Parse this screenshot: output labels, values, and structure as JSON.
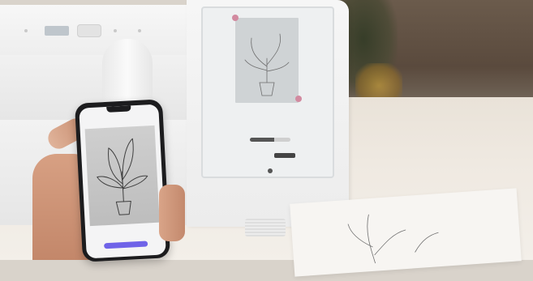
{
  "scene": {
    "description_label": "",
    "colors": {
      "machine_white": "#f2f2f2",
      "phone_black": "#1c1c1e",
      "phone_button": "#6f63e8",
      "screen_accent": "#d28aa0",
      "table": "#efe9e1"
    }
  },
  "phone": {
    "title": "",
    "button_label": ""
  },
  "machine_screen": {
    "caption": "",
    "left_label": "",
    "right_label": ""
  },
  "icons": {
    "plant_drawing": "plant-sketch-icon"
  }
}
